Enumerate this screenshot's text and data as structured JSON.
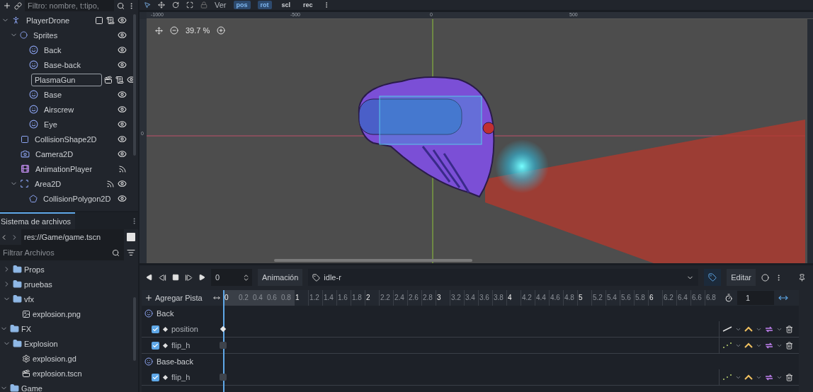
{
  "scene_tree": {
    "filter_placeholder": "Filtro: nombre, t:tipo,",
    "nodes": [
      {
        "name": "PlayerDrone",
        "kind": "character",
        "selected": false,
        "expanded": true,
        "badges": [
          {
            "kind": "group"
          },
          {
            "kind": "script"
          },
          {
            "kind": "eye"
          }
        ],
        "children": [
          {
            "name": "Sprites",
            "kind": "node2d",
            "selected": false,
            "expanded": true,
            "badges": [
              {
                "kind": "eye"
              }
            ],
            "children": [
              {
                "name": "Back",
                "kind": "sprite",
                "selected": false,
                "badges": [
                  {
                    "kind": "eye"
                  }
                ]
              },
              {
                "name": "Base-back",
                "kind": "sprite",
                "selected": false,
                "badges": [
                  {
                    "kind": "eye"
                  }
                ]
              },
              {
                "name": "PlasmaGun",
                "kind": "node2d",
                "selected": true,
                "badges": [
                  {
                    "kind": "scene"
                  },
                  {
                    "kind": "script"
                  },
                  {
                    "kind": "eye"
                  }
                ]
              },
              {
                "name": "Base",
                "kind": "sprite",
                "selected": false,
                "badges": [
                  {
                    "kind": "eye"
                  }
                ]
              },
              {
                "name": "Airscrew",
                "kind": "sprite",
                "selected": false,
                "badges": [
                  {
                    "kind": "eye"
                  }
                ]
              },
              {
                "name": "Eye",
                "kind": "sprite",
                "selected": false,
                "badges": [
                  {
                    "kind": "eye"
                  }
                ]
              }
            ]
          },
          {
            "name": "CollisionShape2D",
            "kind": "rect",
            "selected": false,
            "badges": [
              {
                "kind": "eye"
              }
            ]
          },
          {
            "name": "Camera2D",
            "kind": "camera",
            "selected": false,
            "badges": [
              {
                "kind": "eye"
              }
            ]
          },
          {
            "name": "AnimationPlayer",
            "kind": "anim",
            "selected": false,
            "badges": [
              {
                "kind": "signal"
              }
            ]
          },
          {
            "name": "Area2D",
            "kind": "area",
            "selected": false,
            "expanded": true,
            "badges": [
              {
                "kind": "signal"
              },
              {
                "kind": "eye"
              }
            ],
            "children": [
              {
                "name": "CollisionPolygon2D",
                "kind": "polygon",
                "selected": false,
                "badges": [
                  {
                    "kind": "eye"
                  }
                ]
              }
            ]
          }
        ]
      }
    ]
  },
  "filesystem": {
    "title": "Sistema de archivos",
    "path": "res://Game/game.tscn",
    "filter_placeholder": "Filtrar Archivos",
    "items": [
      {
        "children": [
          {
            "name": "Props",
            "kind": "folder",
            "expanded": false
          },
          {
            "name": "pruebas",
            "kind": "folder",
            "expanded": false
          },
          {
            "name": "vfx",
            "kind": "folder",
            "expanded": true,
            "children": [
              {
                "name": "explosion.png",
                "kind": "image"
              }
            ]
          }
        ]
      },
      {
        "name": "FX",
        "kind": "folder",
        "expanded": true,
        "children": [
          {
            "name": "Explosion",
            "kind": "folder",
            "expanded": true,
            "children": [
              {
                "name": "explosion.gd",
                "kind": "script"
              },
              {
                "name": "explosion.tscn",
                "kind": "scene"
              }
            ]
          }
        ]
      },
      {
        "name": "Game",
        "kind": "folder",
        "expanded": true
      }
    ]
  },
  "toolbar": {
    "view_menu": "Ver",
    "toggles": [
      {
        "label": "pos",
        "selected": true
      },
      {
        "label": "rot",
        "selected": true
      },
      {
        "label": "scl",
        "selected": false
      },
      {
        "label": "rec",
        "selected": false
      }
    ]
  },
  "viewport": {
    "zoom": "39.7 %",
    "ruler_labels": [
      "-1000",
      "-500",
      "0",
      "500"
    ],
    "side_ruler_label": "0"
  },
  "animation": {
    "time": "0",
    "animation_label": "Animación",
    "animation": "idle-r",
    "edit": "Editar",
    "add_track": "Agregar Pista",
    "step": "1",
    "ticks": [
      {
        "label": "0",
        "kind": "start"
      },
      {
        "label": "0.2",
        "kind": "shaded"
      },
      {
        "label": "0.4",
        "kind": "shaded"
      },
      {
        "label": "0.6",
        "kind": "shaded"
      },
      {
        "label": "0.8",
        "kind": "shaded"
      },
      {
        "label": "1",
        "kind": "major"
      },
      {
        "label": "1.2",
        "kind": "minor"
      },
      {
        "label": "1.4",
        "kind": "minor"
      },
      {
        "label": "1.6",
        "kind": "minor"
      },
      {
        "label": "1.8",
        "kind": "minor"
      },
      {
        "label": "2",
        "kind": "major"
      },
      {
        "label": "2.2",
        "kind": "minor"
      },
      {
        "label": "2.4",
        "kind": "minor"
      },
      {
        "label": "2.6",
        "kind": "minor"
      },
      {
        "label": "2.8",
        "kind": "minor"
      },
      {
        "label": "3",
        "kind": "major"
      },
      {
        "label": "3.2",
        "kind": "minor"
      },
      {
        "label": "3.4",
        "kind": "minor"
      },
      {
        "label": "3.6",
        "kind": "minor"
      },
      {
        "label": "3.8",
        "kind": "minor"
      },
      {
        "label": "4",
        "kind": "major"
      },
      {
        "label": "4.2",
        "kind": "minor"
      },
      {
        "label": "4.4",
        "kind": "minor"
      },
      {
        "label": "4.6",
        "kind": "minor"
      },
      {
        "label": "4.8",
        "kind": "minor"
      },
      {
        "label": "5",
        "kind": "major"
      },
      {
        "label": "5.2",
        "kind": "minor"
      },
      {
        "label": "5.4",
        "kind": "minor"
      },
      {
        "label": "5.6",
        "kind": "minor"
      },
      {
        "label": "5.8",
        "kind": "minor"
      },
      {
        "label": "6",
        "kind": "major"
      },
      {
        "label": "6.2",
        "kind": "minor"
      },
      {
        "label": "6.4",
        "kind": "minor"
      },
      {
        "label": "6.6",
        "kind": "minor"
      },
      {
        "label": "6.8",
        "kind": "minor"
      }
    ],
    "groups": [
      {
        "name": "Back",
        "tracks": [
          {
            "name": "position",
            "checked": true,
            "kind": "continuous"
          },
          {
            "name": "flip_h",
            "checked": true,
            "kind": "discrete"
          }
        ]
      },
      {
        "name": "Base-back",
        "tracks": [
          {
            "name": "flip_h",
            "checked": true,
            "kind": "discrete"
          }
        ]
      }
    ]
  }
}
